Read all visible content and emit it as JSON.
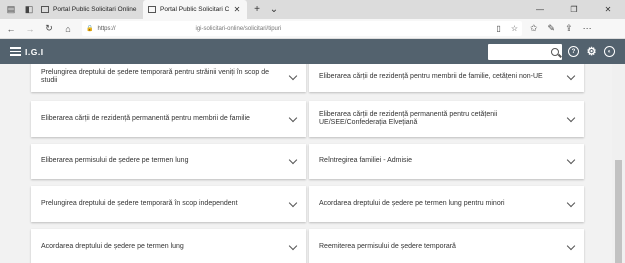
{
  "browser": {
    "tabs": [
      {
        "title": "Portal Public Solicitari Online"
      },
      {
        "title": "Portal Public Solicitari C"
      }
    ],
    "new_tab_glyph": "+",
    "tab_menu_glyph": "⌄",
    "url_protocol": "https://",
    "url_host": "igi-solicitari-online/solicitari/tipuri"
  },
  "app": {
    "brand": "I.G.I",
    "search_placeholder": "",
    "header_color": "#53626e"
  },
  "cards": [
    {
      "left": "Prelungirea dreptului de ședere temporară pentru străinii veniți în scop de studii",
      "right": "Eliberarea cărții de rezidență pentru membrii de familie, cetățeni non-UE"
    },
    {
      "left": "Eliberarea cărții de rezidență permanentă pentru membrii de familie",
      "right": "Eliberarea cărții de rezidență permanentă pentru cetățenii UE/SEE/Confederația Elvețiană"
    },
    {
      "left": "Eliberarea permisului de ședere pe termen lung",
      "right": "Reîntregirea familiei - Admisie"
    },
    {
      "left": "Prelungirea dreptului de ședere temporară în scop independent",
      "right": "Acordarea dreptului de ședere pe termen lung pentru minori"
    },
    {
      "left": "Acordarea dreptului de ședere pe termen lung",
      "right": "Reemiterea permisului de ședere temporară"
    }
  ]
}
